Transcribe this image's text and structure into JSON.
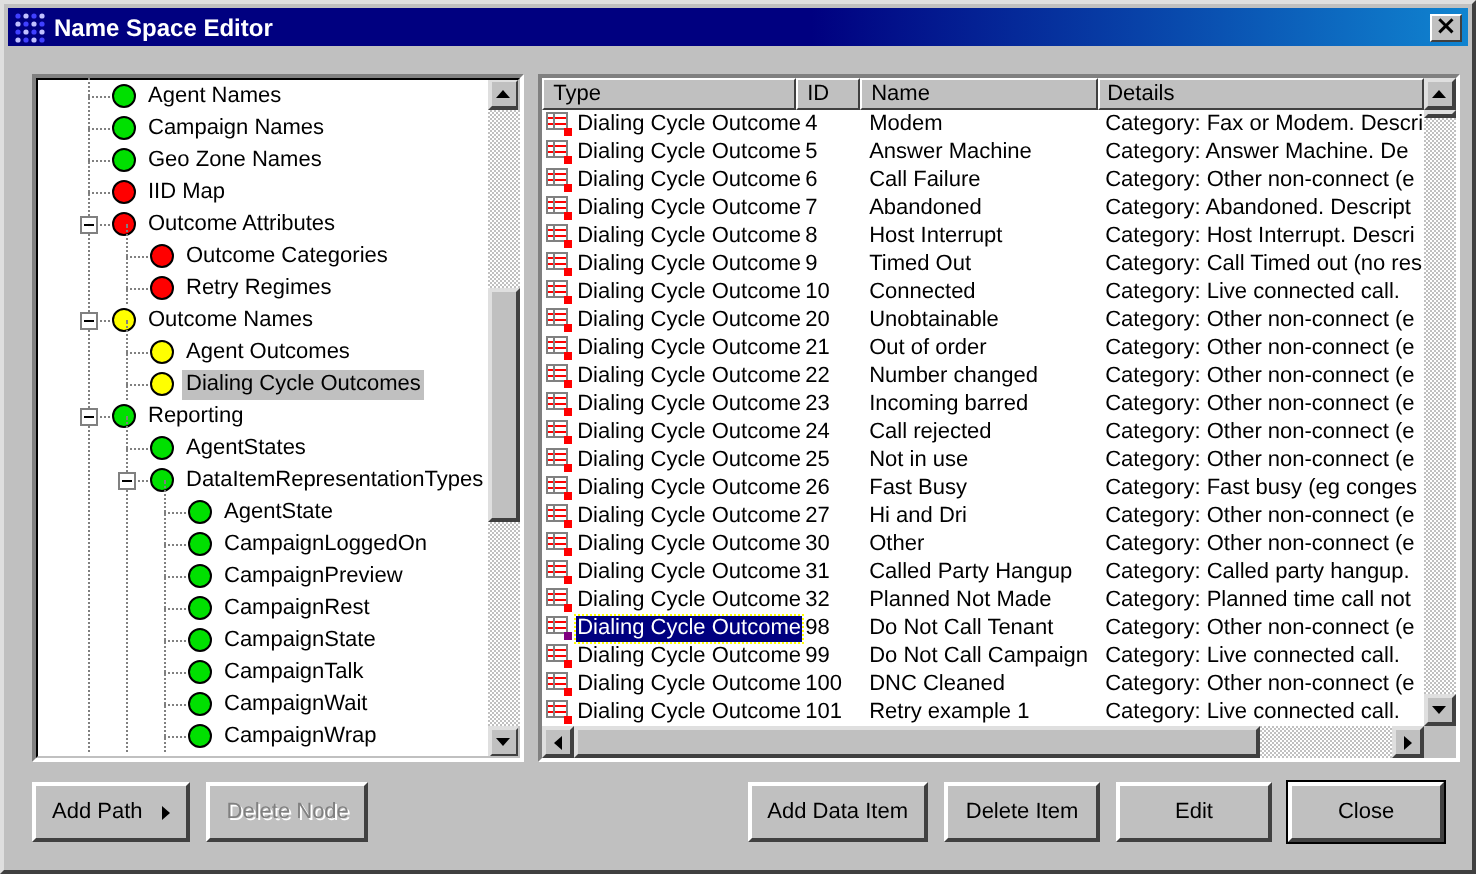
{
  "window": {
    "title": "Name Space Editor",
    "close_glyph": "×"
  },
  "tree": [
    {
      "label": "Agent Names",
      "color": "#00e000",
      "selected": false
    },
    {
      "label": "Campaign Names",
      "color": "#00e000",
      "selected": false
    },
    {
      "label": "Geo Zone Names",
      "color": "#00e000",
      "selected": false
    },
    {
      "label": "IID Map",
      "color": "#ff0000",
      "selected": false
    },
    {
      "label": "Outcome Attributes",
      "color": "#ff0000",
      "selected": false,
      "expanded": true,
      "children": [
        {
          "label": "Outcome Categories",
          "color": "#ff0000",
          "selected": false
        },
        {
          "label": "Retry Regimes",
          "color": "#ff0000",
          "selected": false
        }
      ]
    },
    {
      "label": "Outcome Names",
      "color": "#ffff00",
      "selected": false,
      "expanded": true,
      "children": [
        {
          "label": "Agent Outcomes",
          "color": "#ffff00",
          "selected": false
        },
        {
          "label": "Dialing Cycle Outcomes",
          "color": "#ffff00",
          "selected": true
        }
      ]
    },
    {
      "label": "Reporting",
      "color": "#00e000",
      "selected": false,
      "expanded": true,
      "children": [
        {
          "label": "AgentStates",
          "color": "#00e000",
          "selected": false
        },
        {
          "label": "DataItemRepresentationTypes",
          "color": "#00e000",
          "selected": false,
          "expanded": true,
          "children": [
            {
              "label": "AgentState",
              "color": "#00e000",
              "selected": false
            },
            {
              "label": "CampaignLoggedOn",
              "color": "#00e000",
              "selected": false
            },
            {
              "label": "CampaignPreview",
              "color": "#00e000",
              "selected": false
            },
            {
              "label": "CampaignRest",
              "color": "#00e000",
              "selected": false
            },
            {
              "label": "CampaignState",
              "color": "#00e000",
              "selected": false
            },
            {
              "label": "CampaignTalk",
              "color": "#00e000",
              "selected": false
            },
            {
              "label": "CampaignWait",
              "color": "#00e000",
              "selected": false
            },
            {
              "label": "CampaignWrap",
              "color": "#00e000",
              "selected": false
            }
          ]
        }
      ]
    }
  ],
  "table": {
    "columns": [
      "Type",
      "ID",
      "Name",
      "Details"
    ],
    "rows": [
      {
        "type": "Dialing Cycle Outcome",
        "id": "4",
        "name": "Modem",
        "details": "Category: Fax or Modem. Descri",
        "selected": false
      },
      {
        "type": "Dialing Cycle Outcome",
        "id": "5",
        "name": "Answer Machine",
        "details": "Category: Answer Machine. De",
        "selected": false
      },
      {
        "type": "Dialing Cycle Outcome",
        "id": "6",
        "name": "Call Failure",
        "details": "Category: Other non-connect (e",
        "selected": false
      },
      {
        "type": "Dialing Cycle Outcome",
        "id": "7",
        "name": "Abandoned",
        "details": "Category: Abandoned. Descript",
        "selected": false
      },
      {
        "type": "Dialing Cycle Outcome",
        "id": "8",
        "name": "Host Interrupt",
        "details": "Category: Host Interrupt. Descri",
        "selected": false
      },
      {
        "type": "Dialing Cycle Outcome",
        "id": "9",
        "name": "Timed Out",
        "details": "Category: Call Timed out (no res",
        "selected": false
      },
      {
        "type": "Dialing Cycle Outcome",
        "id": "10",
        "name": "Connected",
        "details": "Category: Live connected call.",
        "selected": false
      },
      {
        "type": "Dialing Cycle Outcome",
        "id": "20",
        "name": "Unobtainable",
        "details": "Category: Other non-connect (e",
        "selected": false
      },
      {
        "type": "Dialing Cycle Outcome",
        "id": "21",
        "name": "Out of order",
        "details": "Category: Other non-connect (e",
        "selected": false
      },
      {
        "type": "Dialing Cycle Outcome",
        "id": "22",
        "name": "Number changed",
        "details": "Category: Other non-connect (e",
        "selected": false
      },
      {
        "type": "Dialing Cycle Outcome",
        "id": "23",
        "name": "Incoming barred",
        "details": "Category: Other non-connect (e",
        "selected": false
      },
      {
        "type": "Dialing Cycle Outcome",
        "id": "24",
        "name": "Call rejected",
        "details": "Category: Other non-connect (e",
        "selected": false
      },
      {
        "type": "Dialing Cycle Outcome",
        "id": "25",
        "name": "Not in use",
        "details": "Category: Other non-connect (e",
        "selected": false
      },
      {
        "type": "Dialing Cycle Outcome",
        "id": "26",
        "name": "Fast Busy",
        "details": "Category: Fast busy (eg conges",
        "selected": false
      },
      {
        "type": "Dialing Cycle Outcome",
        "id": "27",
        "name": "Hi and Dri",
        "details": "Category: Other non-connect (e",
        "selected": false
      },
      {
        "type": "Dialing Cycle Outcome",
        "id": "30",
        "name": "Other",
        "details": "Category: Other non-connect (e",
        "selected": false
      },
      {
        "type": "Dialing Cycle Outcome",
        "id": "31",
        "name": "Called Party Hangup",
        "details": "Category: Called party hangup.",
        "selected": false
      },
      {
        "type": "Dialing Cycle Outcome",
        "id": "32",
        "name": "Planned Not Made",
        "details": "Category: Planned time call not",
        "selected": false
      },
      {
        "type": "Dialing Cycle Outcome",
        "id": "98",
        "name": "Do Not Call Tenant",
        "details": "Category: Other non-connect (e",
        "selected": true
      },
      {
        "type": "Dialing Cycle Outcome",
        "id": "99",
        "name": "Do Not Call Campaign",
        "details": "Category: Live connected call.",
        "selected": false
      },
      {
        "type": "Dialing Cycle Outcome",
        "id": "100",
        "name": "DNC Cleaned",
        "details": "Category: Other non-connect (e",
        "selected": false
      },
      {
        "type": "Dialing Cycle Outcome",
        "id": "101",
        "name": "Retry example 1",
        "details": "Category: Live connected call.",
        "selected": false
      }
    ]
  },
  "buttons": [
    {
      "label": "Add Path",
      "kind": "menu",
      "disabled": false,
      "default": false
    },
    {
      "label": "Delete Node",
      "kind": "plain",
      "disabled": true,
      "default": false
    },
    {
      "label": "Add Data Item",
      "kind": "plain",
      "disabled": false,
      "default": false
    },
    {
      "label": "Delete Item",
      "kind": "plain",
      "disabled": false,
      "default": false
    },
    {
      "label": "Edit",
      "kind": "plain",
      "disabled": false,
      "default": false
    },
    {
      "label": "Close",
      "kind": "plain",
      "disabled": false,
      "default": true
    }
  ]
}
